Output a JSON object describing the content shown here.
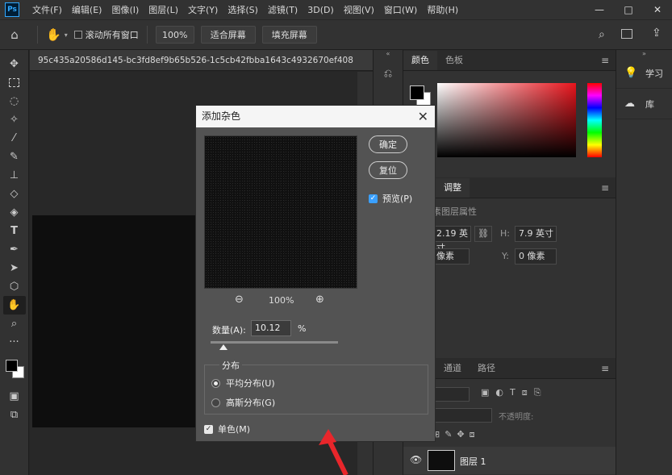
{
  "menubar": {
    "logo": "Ps",
    "items": [
      "文件(F)",
      "编辑(E)",
      "图像(I)",
      "图层(L)",
      "文字(Y)",
      "选择(S)",
      "滤镜(T)",
      "3D(D)",
      "视图(V)",
      "窗口(W)",
      "帮助(H)"
    ],
    "window_buttons": [
      "—",
      "□",
      "✕"
    ]
  },
  "optbar": {
    "scroll_all_label": "滚动所有窗口",
    "zoom_value": "100%",
    "fit_screen": "适合屏幕",
    "fill_screen": "填充屏幕"
  },
  "document": {
    "tab_title": "95c435a20586d145-bc3fd8ef9b65b526-1c5cb42fbba1643c4932670ef408"
  },
  "color_panel": {
    "tabs": [
      "颜色",
      "色板"
    ],
    "foreground": "#000000",
    "background": "#ffffff"
  },
  "props_panel": {
    "tabs": [
      "调整"
    ],
    "title": "素图层属性",
    "w_value": "2.19 英寸",
    "h_label": "H:",
    "h_value": "7.9 英寸",
    "x_value": "像素",
    "y_label": "Y:",
    "y_value": "0 像素"
  },
  "layers_panel": {
    "tabs": [
      "通道",
      "路径"
    ],
    "opacity_label": "不透明度:",
    "layer_name": "图层 1"
  },
  "learn_panel": {
    "items": [
      {
        "icon": "lightbulb-icon",
        "label": "学习"
      },
      {
        "icon": "library-icon",
        "label": "库"
      }
    ]
  },
  "dialog": {
    "title": "添加杂色",
    "ok": "确定",
    "reset": "复位",
    "preview_label": "预览(P)",
    "zoom": "100%",
    "amount_label": "数量(A):",
    "amount_value": "10.12",
    "amount_unit": "%",
    "amount_slider_fraction": 0.1012,
    "distribution_label": "分布",
    "uniform": "平均分布(U)",
    "gaussian": "高斯分布(G)",
    "monochrome": "单色(M)"
  },
  "colors": {
    "accent_blue": "#3aa0ff",
    "arrow_red": "#e8262b"
  }
}
